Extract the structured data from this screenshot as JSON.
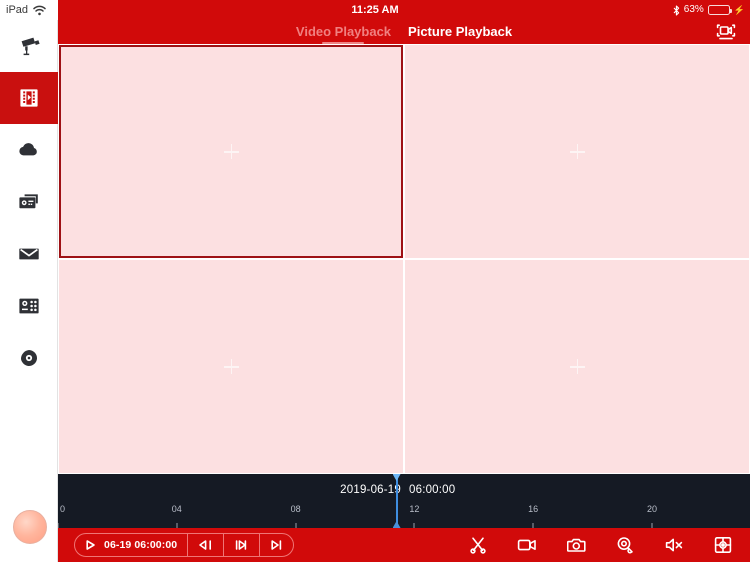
{
  "statusbar": {
    "device_label": "iPad",
    "wifi_icon": "wifi-icon",
    "time": "11:25 AM",
    "bluetooth_icon": "bluetooth-icon",
    "battery_percent": "63%",
    "battery_level": 63,
    "battery_color": "#2fd44a",
    "charging_icon": "charging-bolt-icon"
  },
  "sidebar": {
    "items": [
      {
        "name": "live-view",
        "icon": "cctv-camera-icon",
        "active": false
      },
      {
        "name": "playback",
        "icon": "film-strip-icon",
        "active": true
      },
      {
        "name": "cloud",
        "icon": "cloud-icon",
        "active": false
      },
      {
        "name": "devices",
        "icon": "nvr-device-icon",
        "active": false
      },
      {
        "name": "messages",
        "icon": "envelope-icon",
        "active": false
      },
      {
        "name": "control-panel",
        "icon": "control-panel-icon",
        "active": false
      },
      {
        "name": "more",
        "icon": "disc-icon",
        "active": false
      }
    ],
    "avatar": "user-avatar"
  },
  "header": {
    "tabs": [
      {
        "label": "Video Playback",
        "state": "dim",
        "underlined": true
      },
      {
        "label": "Picture Playback",
        "state": "bright",
        "underlined": false
      }
    ],
    "channel_button_icon": "add-camera-icon"
  },
  "grid": {
    "panes": [
      {
        "name": "video-pane-1",
        "selected": true,
        "placeholder_icon": "plus-icon"
      },
      {
        "name": "video-pane-2",
        "selected": false,
        "placeholder_icon": "plus-icon"
      },
      {
        "name": "video-pane-3",
        "selected": false,
        "placeholder_icon": "plus-icon"
      },
      {
        "name": "video-pane-4",
        "selected": false,
        "placeholder_icon": "plus-icon"
      }
    ],
    "pane_color": "#fce0e1",
    "selection_color": "#9e1115"
  },
  "timeline": {
    "date": "2019-06-19",
    "time": "06:00:00",
    "playhead_hour": 11.4,
    "playhead_color": "#3f8ee0",
    "background": "#151a24",
    "ticks": [
      {
        "label": "0",
        "hour": 0
      },
      {
        "label": "04",
        "hour": 4
      },
      {
        "label": "08",
        "hour": 8
      },
      {
        "label": "12",
        "hour": 12
      },
      {
        "label": "16",
        "hour": 16
      },
      {
        "label": "20",
        "hour": 20
      }
    ],
    "hour_span": 23.3
  },
  "toolbar": {
    "background": "#d10a0a",
    "playback_pill": {
      "play_icon": "play-icon",
      "current_time": "06-19 06:00:00",
      "rewind_icon": "rewind-icon",
      "fast_forward_icon": "fast-forward-icon",
      "next_frame_icon": "next-frame-icon"
    },
    "right_buttons": [
      {
        "name": "clip-button",
        "icon": "scissors-icon"
      },
      {
        "name": "record-button",
        "icon": "video-camera-icon"
      },
      {
        "name": "snapshot-button",
        "icon": "camera-icon"
      },
      {
        "name": "digital-zoom-button",
        "icon": "magnifier-icon"
      },
      {
        "name": "mute-button",
        "icon": "speaker-mute-icon"
      },
      {
        "name": "ptz-button",
        "icon": "ptz-target-icon"
      }
    ]
  }
}
